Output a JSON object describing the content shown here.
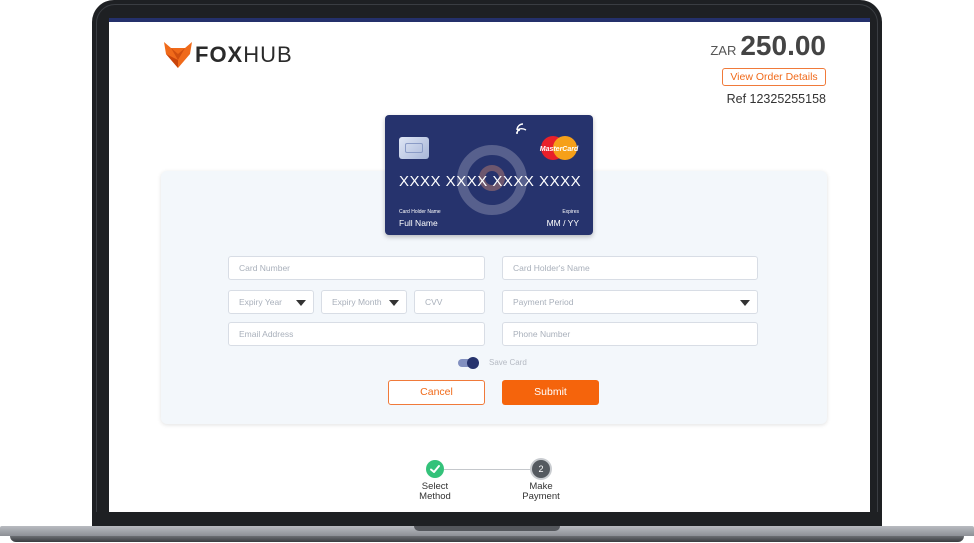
{
  "header": {
    "logo_bold": "FOX",
    "logo_light": "HUB",
    "currency": "ZAR",
    "amount": "250.00",
    "order_details_label": "View Order Details",
    "reference": "Ref 12325255158"
  },
  "card_preview": {
    "number": "XXXX XXXX XXXX XXXX",
    "holder_label": "Card Holder Name",
    "holder_value": "Full Name",
    "expires_label": "Expires",
    "expires_value": "MM / YY",
    "brand": "MasterCard"
  },
  "form": {
    "card_number_placeholder": "Card Number",
    "card_holder_placeholder": "Card Holder's Name",
    "expiry_year_placeholder": "Expiry Year",
    "expiry_month_placeholder": "Expiry Month",
    "cvv_placeholder": "CVV",
    "payment_period_placeholder": "Payment Period",
    "email_placeholder": "Email Address",
    "phone_placeholder": "Phone Number",
    "save_card_label": "Save Card",
    "save_card_on": true,
    "cancel_label": "Cancel",
    "submit_label": "Submit"
  },
  "stepper": {
    "steps": [
      {
        "number": "1",
        "label_line1": "Select",
        "label_line2": "Method",
        "status": "complete"
      },
      {
        "number": "2",
        "label_line1": "Make",
        "label_line2": "Payment",
        "status": "current"
      }
    ]
  },
  "colors": {
    "brand_orange": "#f5640c",
    "card_navy": "#26336d",
    "success_green": "#34c27a"
  }
}
